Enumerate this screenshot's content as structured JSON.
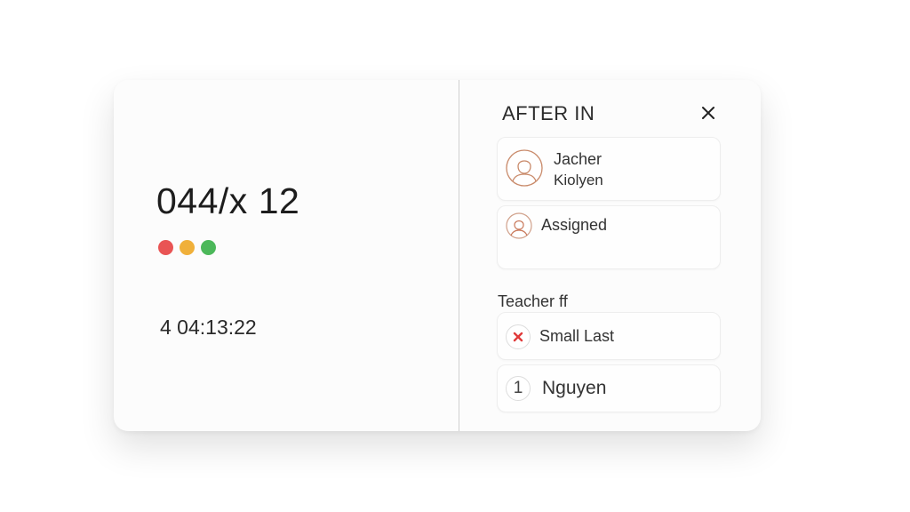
{
  "left": {
    "code": "044/x 12",
    "status_dots": [
      "#e95454",
      "#f0b03a",
      "#4cb85a"
    ],
    "timer": "4  04:13:22"
  },
  "panel": {
    "title": "AFTER IN",
    "close_icon": "close-icon",
    "teacher_card": {
      "line1": "Jacher",
      "line2": "Kiolyen",
      "icon": "user-avatar-icon"
    },
    "assigned_card": {
      "label": "Assigned",
      "icon": "user-avatar-icon"
    },
    "section_label": "Teacher  ff",
    "rows": [
      {
        "label": "Small Last",
        "icon": "remove-x-icon"
      },
      {
        "label": "Nguyen",
        "badge": "1"
      }
    ]
  },
  "colors": {
    "accent_red": "#e03a3a",
    "avatar_stroke": "#c98a6a"
  }
}
